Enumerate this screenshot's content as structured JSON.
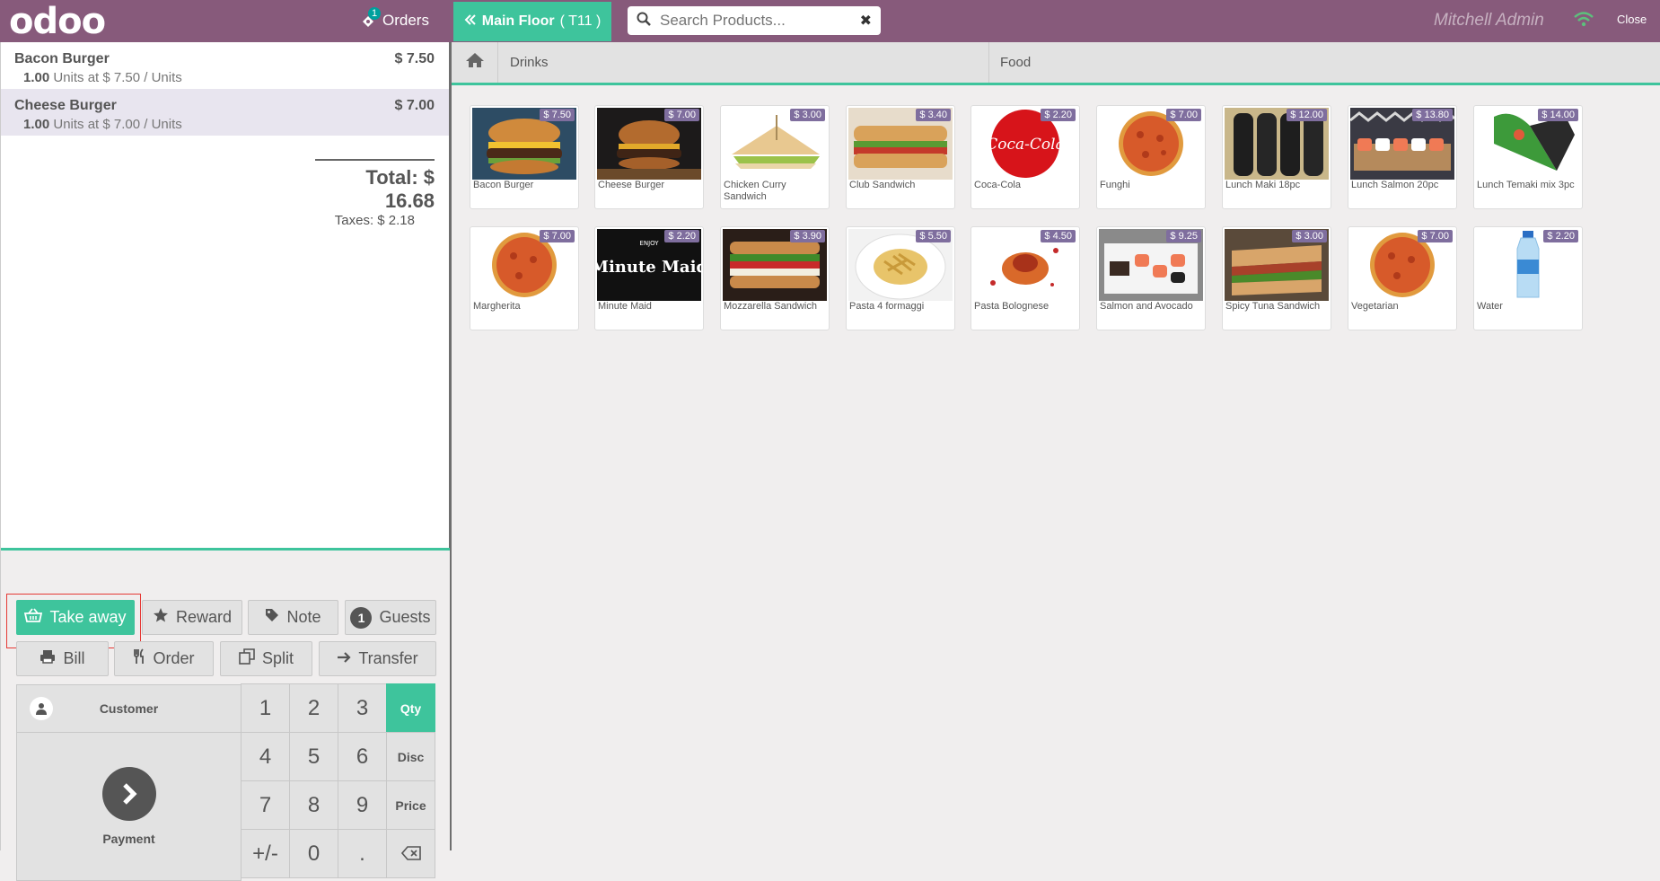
{
  "header": {
    "logo": "odoo",
    "orders_label": "Orders",
    "orders_badge": "1",
    "floor_label": "Main Floor",
    "table_label": "( T11 )",
    "search_placeholder": "Search Products...",
    "user_name": "Mitchell Admin",
    "close_label": "Close"
  },
  "order": {
    "lines": [
      {
        "name": "Bacon Burger",
        "price": "$ 7.50",
        "qty": "1.00",
        "info": " Units at $ 7.50 / Units"
      },
      {
        "name": "Cheese Burger",
        "price": "$ 7.00",
        "qty": "1.00",
        "info": " Units at $ 7.00 / Units"
      }
    ],
    "total": "Total: $ 16.68",
    "taxes": "Taxes: $ 2.18"
  },
  "controls": {
    "take_away": "Take away",
    "reward": "Reward",
    "note": "Note",
    "guests_count": "1",
    "guests": "Guests",
    "bill": "Bill",
    "order": "Order",
    "split": "Split",
    "transfer": "Transfer",
    "customer": "Customer",
    "payment": "Payment"
  },
  "numpad": {
    "keys": [
      "1",
      "2",
      "3",
      "Qty",
      "4",
      "5",
      "6",
      "Disc",
      "7",
      "8",
      "9",
      "Price",
      "+/-",
      "0",
      ".",
      "⌫"
    ]
  },
  "categories": [
    "Drinks",
    "Food"
  ],
  "products": [
    {
      "name": "Bacon Burger",
      "price": "$ 7.50"
    },
    {
      "name": "Cheese Burger",
      "price": "$ 7.00"
    },
    {
      "name": "Chicken Curry Sandwich",
      "price": "$ 3.00"
    },
    {
      "name": "Club Sandwich",
      "price": "$ 3.40"
    },
    {
      "name": "Coca-Cola",
      "price": "$ 2.20"
    },
    {
      "name": "Funghi",
      "price": "$ 7.00"
    },
    {
      "name": "Lunch Maki 18pc",
      "price": "$ 12.00"
    },
    {
      "name": "Lunch Salmon 20pc",
      "price": "$ 13.80"
    },
    {
      "name": "Lunch Temaki mix 3pc",
      "price": "$ 14.00"
    },
    {
      "name": "Margherita",
      "price": "$ 7.00"
    },
    {
      "name": "Minute Maid",
      "price": "$ 2.20"
    },
    {
      "name": "Mozzarella Sandwich",
      "price": "$ 3.90"
    },
    {
      "name": "Pasta 4 formaggi",
      "price": "$ 5.50"
    },
    {
      "name": "Pasta Bolognese",
      "price": "$ 4.50"
    },
    {
      "name": "Salmon and Avocado",
      "price": "$ 9.25"
    },
    {
      "name": "Spicy Tuna Sandwich",
      "price": "$ 3.00"
    },
    {
      "name": "Vegetarian",
      "price": "$ 7.00"
    },
    {
      "name": "Water",
      "price": "$ 2.20"
    }
  ],
  "product_images": {
    "coca_cola_text": "Coca-Cola",
    "minute_maid_small": "ENJOY",
    "minute_maid_text": "Minute Maid"
  },
  "colors": {
    "header": "#875a7b",
    "accent": "#3ec49c",
    "price_badge": "#7f6e9e"
  }
}
